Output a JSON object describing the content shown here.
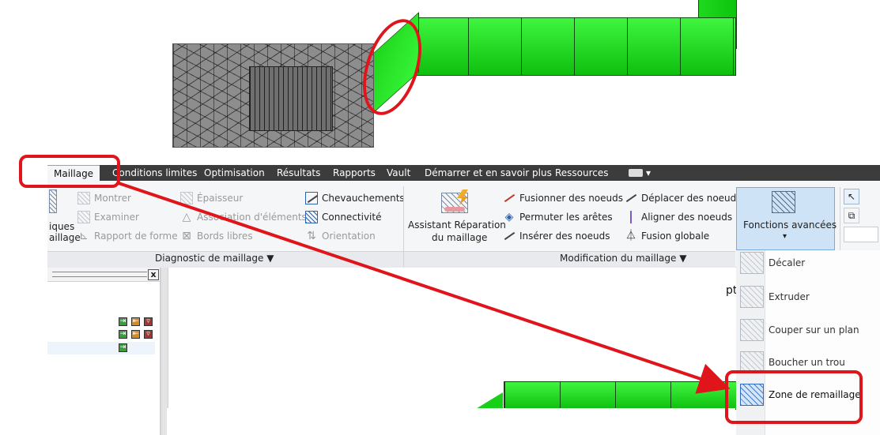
{
  "ribbon": {
    "tabs": [
      {
        "label": "Maillage",
        "active": true
      },
      {
        "label": "Conditions limites"
      },
      {
        "label": "Optimisation"
      },
      {
        "label": "Résultats"
      },
      {
        "label": "Rapports"
      },
      {
        "label": "Vault"
      },
      {
        "label": "Démarrer et en savoir plus"
      },
      {
        "label": "Ressources"
      }
    ],
    "diagnostic": {
      "partial_label_1": "iques",
      "partial_label_2": "aillage",
      "montrer": "Montrer",
      "examiner": "Examiner",
      "rapport_de_forme": "Rapport de forme",
      "epaisseur": "Épaisseur",
      "association": "Association d'éléments",
      "bords_libres": "Bords libres",
      "chevauchements": "Chevauchements",
      "connectivite": "Connectivité",
      "orientation": "Orientation",
      "panel_label": "Diagnostic de maillage ▼"
    },
    "modification": {
      "assistant_line1": "Assistant Réparation",
      "assistant_line2": "du maillage",
      "fusionner_noeuds": "Fusionner des noeuds",
      "permuter_aretes": "Permuter les arêtes",
      "inserer_noeuds": "Insérer des noeuds",
      "deplacer_noeuds": "Déplacer des noeuds",
      "aligner_noeuds": "Aligner des noeuds",
      "fusion_globale": "Fusion globale",
      "panel_label": "Modification du maillage ▼"
    },
    "fonctions_avancees": {
      "label": "Fonctions avancées",
      "caret": "▾"
    }
  },
  "dropdown": {
    "items": [
      {
        "label": "Décaler"
      },
      {
        "label": "Extruder"
      },
      {
        "label": "Couper sur un plan"
      },
      {
        "label": "Boucher un trou"
      },
      {
        "label": "Zone de remaillage",
        "highlighted": true
      }
    ]
  },
  "viewport": {
    "partial_text": "pt"
  },
  "left_panel": {
    "close_glyph": "x"
  },
  "colors": {
    "annotation": "#e0151b",
    "mesh_green": "#19d019",
    "ribbon_dark": "#3c3c3c"
  }
}
